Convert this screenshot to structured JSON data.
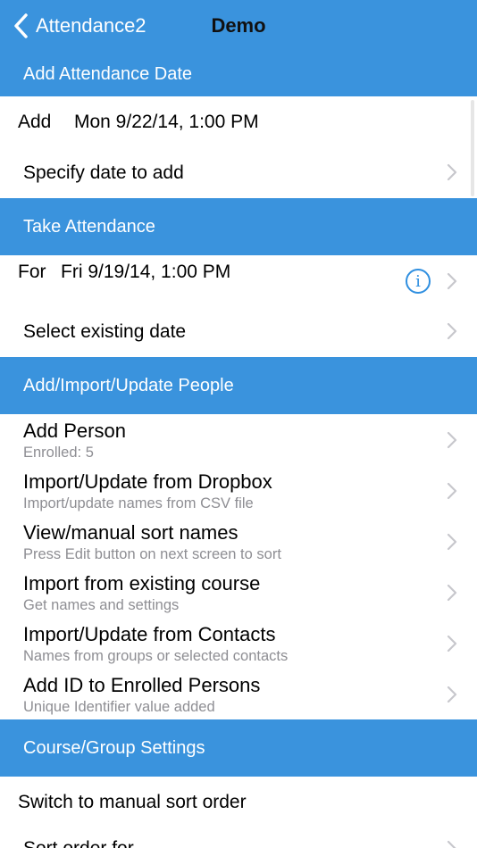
{
  "navbar": {
    "back_label": "Attendance2",
    "title": "Demo"
  },
  "sections": {
    "add_date": "Add Attendance Date",
    "take_attendance": "Take Attendance",
    "people": "Add/Import/Update People",
    "settings": "Course/Group Settings"
  },
  "add_date": {
    "add_word": "Add",
    "add_value": "Mon 9/22/14, 1:00 PM",
    "specify": "Specify date to add"
  },
  "take_attendance": {
    "for_word": "For",
    "for_value": "Fri 9/19/14, 1:00 PM",
    "select_existing": "Select existing date"
  },
  "people": [
    {
      "title": "Add Person",
      "subtitle": "Enrolled: 5"
    },
    {
      "title": "Import/Update from Dropbox",
      "subtitle": "Import/update names from CSV file"
    },
    {
      "title": "View/manual sort names",
      "subtitle": "Press Edit button on next screen to sort"
    },
    {
      "title": "Import from existing course",
      "subtitle": "Get names and settings"
    },
    {
      "title": "Import/Update from Contacts",
      "subtitle": "Names from groups or selected contacts"
    },
    {
      "title": "Add ID to Enrolled Persons",
      "subtitle": "Unique Identifier value added"
    }
  ],
  "settings": {
    "switch_sort": "Switch to manual sort order",
    "partial_next": "Sort order for..."
  },
  "icons": {
    "back": "chevron-left-icon",
    "disclosure": "chevron-right-icon",
    "info": "info-icon"
  },
  "colors": {
    "accent": "#3a93dd",
    "info_blue": "#2f8fe0",
    "subtitle_gray": "#8e8e93",
    "chevron_gray": "#c7c7cc"
  }
}
